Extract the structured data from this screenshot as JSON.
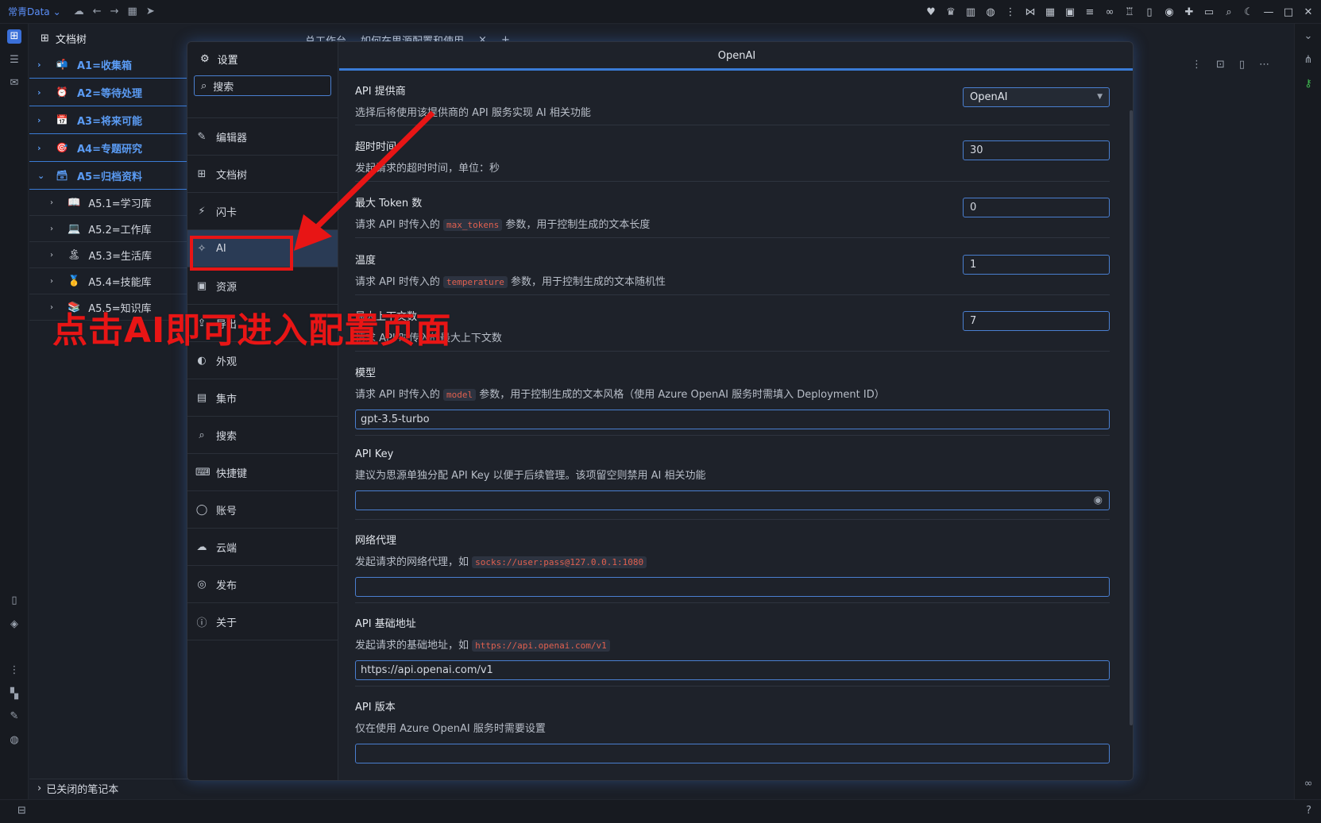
{
  "topbar": {
    "brand": "常青Data"
  },
  "filetree": {
    "title": "文档树",
    "notebooks": [
      {
        "label": "A1=收集箱",
        "emoji": "📬"
      },
      {
        "label": "A2=等待处理",
        "emoji": "⏰"
      },
      {
        "label": "A3=将来可能",
        "emoji": "📅"
      },
      {
        "label": "A4=专题研究",
        "emoji": "🎯"
      },
      {
        "label": "A5=归档资料",
        "emoji": "🗃"
      }
    ],
    "sub_items": [
      {
        "label": "A5.1=学习库",
        "emoji": "📖"
      },
      {
        "label": "A5.2=工作库",
        "emoji": "💻"
      },
      {
        "label": "A5.3=生活库",
        "emoji": "🏝"
      },
      {
        "label": "A5.4=技能库",
        "emoji": "🥇"
      },
      {
        "label": "A5.5=知识库",
        "emoji": "📚"
      }
    ],
    "closed_label": "已关闭的笔记本"
  },
  "editor": {
    "tab_label": "总工作台",
    "tab2_label": "如何在思源配置和使用",
    "close": "×",
    "add": "+"
  },
  "settings": {
    "title": "设置",
    "search_placeholder": "搜索",
    "nav": [
      {
        "label": "编辑器",
        "icon": "✎"
      },
      {
        "label": "文档树",
        "icon": "⊞"
      },
      {
        "label": "闪卡",
        "icon": "⚡"
      },
      {
        "label": "AI",
        "icon": "✧"
      },
      {
        "label": "资源",
        "icon": "▣"
      },
      {
        "label": "导出",
        "icon": "⇪"
      },
      {
        "label": "外观",
        "icon": "◐"
      },
      {
        "label": "集市",
        "icon": "▤"
      },
      {
        "label": "搜索",
        "icon": "⌕"
      },
      {
        "label": "快捷键",
        "icon": "⌨"
      },
      {
        "label": "账号",
        "icon": "◯"
      },
      {
        "label": "云端",
        "icon": "☁"
      },
      {
        "label": "发布",
        "icon": "◎"
      },
      {
        "label": "关于",
        "icon": "ⓘ"
      }
    ],
    "active_index": 3
  },
  "openai": {
    "header": "OpenAI",
    "provider": {
      "label": "API 提供商",
      "desc": "选择后将使用该提供商的 API 服务实现 AI 相关功能",
      "value": "OpenAI"
    },
    "timeout": {
      "label": "超时时间",
      "desc": "发起请求的超时时间，单位：秒",
      "value": "30"
    },
    "max_tokens": {
      "label": "最大 Token 数",
      "desc_pre": "请求 API 时传入的",
      "code": "max_tokens",
      "desc_post": "参数，用于控制生成的文本长度",
      "value": "0"
    },
    "temperature": {
      "label": "温度",
      "desc_pre": "请求 API 时传入的",
      "code": "temperature",
      "desc_post": "参数，用于控制生成的文本随机性",
      "value": "1"
    },
    "context": {
      "label": "最大上下文数",
      "desc": "请求 API 时传入的最大上下文数",
      "value": "7"
    },
    "model": {
      "label": "模型",
      "desc_pre": "请求 API 时传入的",
      "code": "model",
      "desc_post": "参数，用于控制生成的文本风格（使用 Azure OpenAI 服务时需填入 Deployment ID）",
      "value": "gpt-3.5-turbo"
    },
    "api_key": {
      "label": "API Key",
      "desc": "建议为思源单独分配 API Key 以便于后续管理。该项留空则禁用 AI 相关功能",
      "value": ""
    },
    "proxy": {
      "label": "网络代理",
      "desc_pre": "发起请求的网络代理，如",
      "code": "socks://user:pass@127.0.0.1:1080",
      "value": ""
    },
    "base_url": {
      "label": "API 基础地址",
      "desc_pre": "发起请求的基础地址，如",
      "code": "https://api.openai.com/v1",
      "value": "https://api.openai.com/v1"
    },
    "version": {
      "label": "API 版本",
      "desc": "仅在使用 Azure OpenAI 服务时需要设置",
      "value": ""
    }
  },
  "annotation": {
    "text": "点击AI即可进入配置页面",
    "color": "#e81515"
  }
}
